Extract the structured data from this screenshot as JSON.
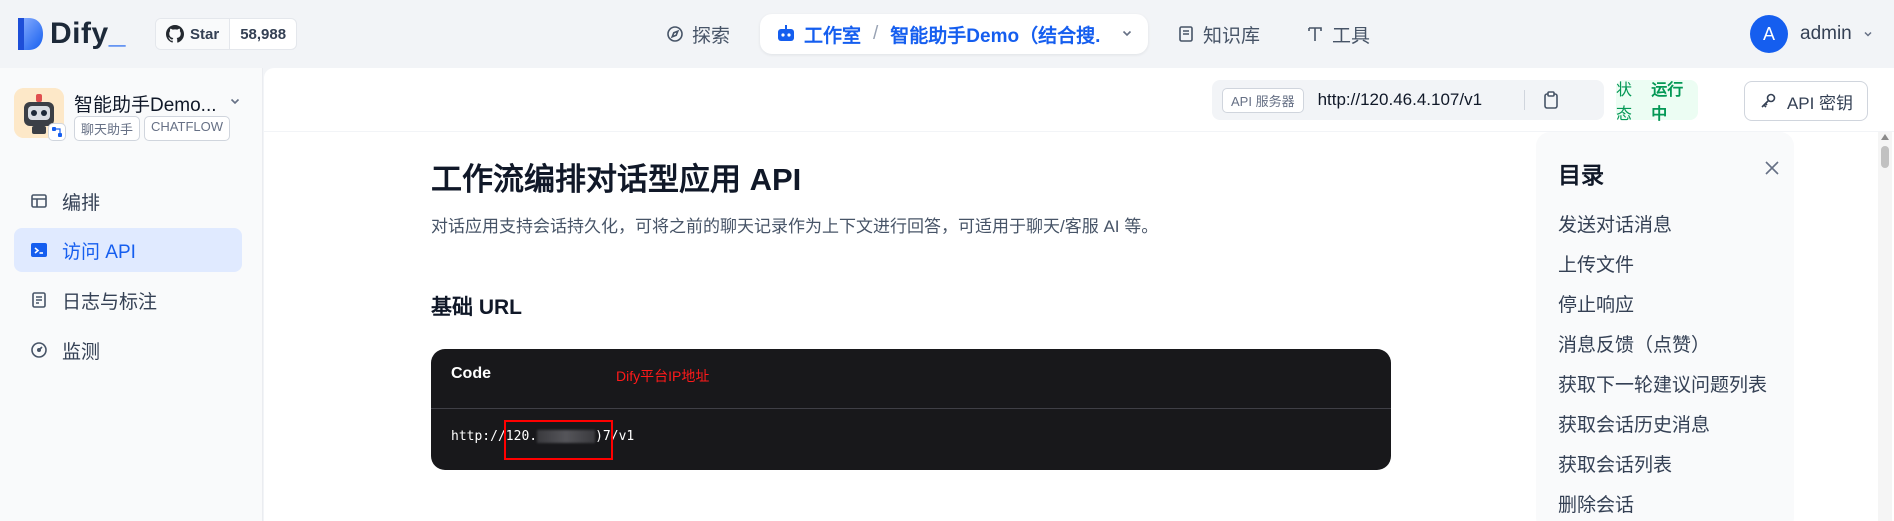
{
  "brand": {
    "name": "Dify",
    "underscore": "_"
  },
  "github": {
    "label": "Star",
    "count": "58,988"
  },
  "nav": {
    "explore": "探索",
    "studio": "工作室",
    "separator": "/",
    "current_app": "智能助手Demo（结合搜...",
    "knowledge": "知识库",
    "tools": "工具"
  },
  "user": {
    "initial": "A",
    "name": "admin"
  },
  "app": {
    "name": "智能助手Demo...",
    "tags": [
      "聊天助手",
      "CHATFLOW"
    ]
  },
  "sidebar": {
    "items": [
      {
        "label": "编排",
        "icon": "layout-icon"
      },
      {
        "label": "访问 API",
        "icon": "terminal-icon"
      },
      {
        "label": "日志与标注",
        "icon": "file-list-icon"
      },
      {
        "label": "监测",
        "icon": "dashboard-icon"
      }
    ]
  },
  "api_bar": {
    "server_label": "API 服务器",
    "server_url": "http://120.46.4.107/v1",
    "status_label": "状态",
    "status_value": "运行中",
    "api_key_label": "API 密钥"
  },
  "doc": {
    "title": "工作流编排对话型应用 API",
    "description": "对话应用支持会话持久化，可将之前的聊天记录作为上下文进行回答，可适用于聊天/客服 AI 等。",
    "base_url_heading": "基础 URL",
    "code": {
      "label": "Code",
      "annotation": "Dify平台IP地址",
      "url_prefix": "http:/",
      "url_ip_start": "/120.",
      "url_suffix": ")7/v1"
    }
  },
  "toc": {
    "title": "目录",
    "items": [
      "发送对话消息",
      "上传文件",
      "停止响应",
      "消息反馈（点赞）",
      "获取下一轮建议问题列表",
      "获取会话历史消息",
      "获取会话列表",
      "删除会话"
    ]
  },
  "colors": {
    "accent": "#155eef",
    "status_green": "#039855",
    "annotation_red": "#ff0000",
    "code_bg": "#18181b"
  }
}
